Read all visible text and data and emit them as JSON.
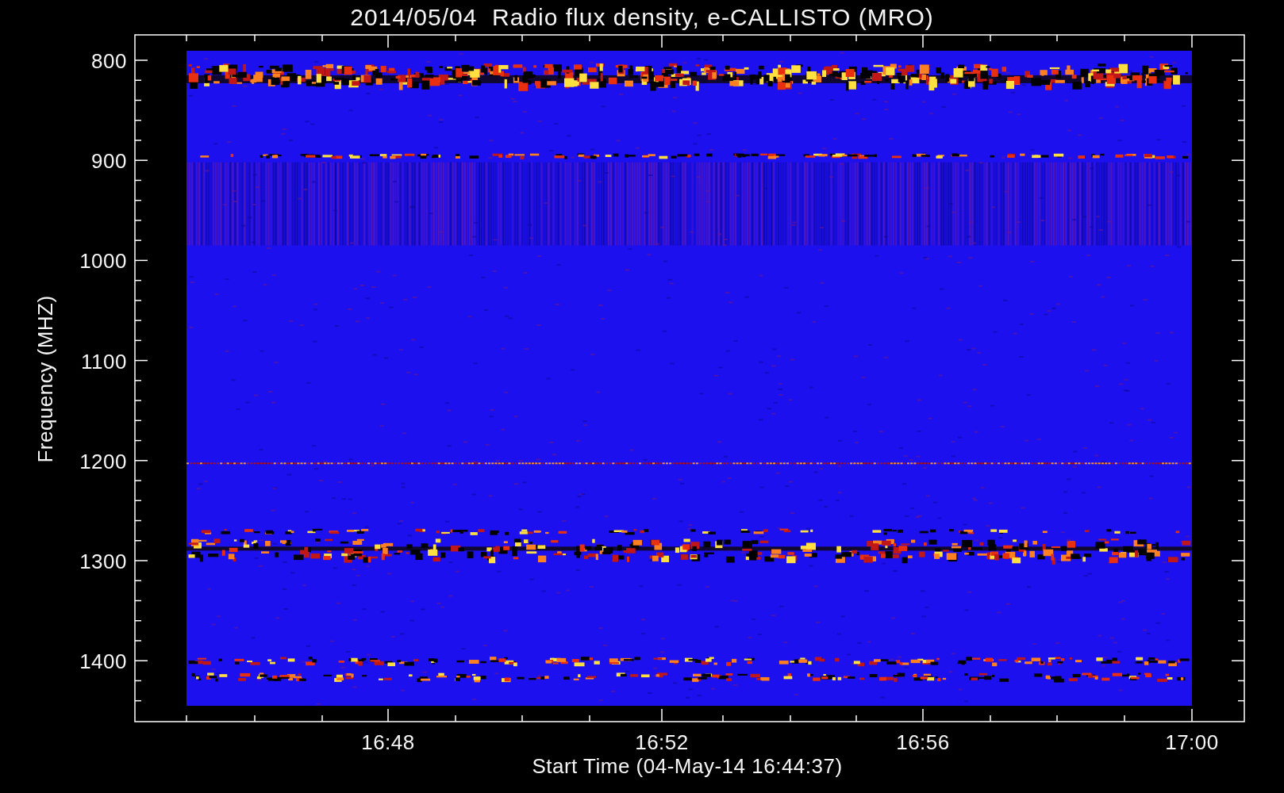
{
  "title": "2014/05/04  Radio flux density, e-CALLISTO (MRO)",
  "y_axis": {
    "label": "Frequency (MHZ)",
    "ticks": [
      "800",
      "900",
      "1000",
      "1100",
      "1200",
      "1300",
      "1400"
    ]
  },
  "x_axis": {
    "label": "Start Time (04-May-14 16:44:37)",
    "ticks": [
      "16:48",
      "16:52",
      "16:56",
      "17:00"
    ]
  }
}
